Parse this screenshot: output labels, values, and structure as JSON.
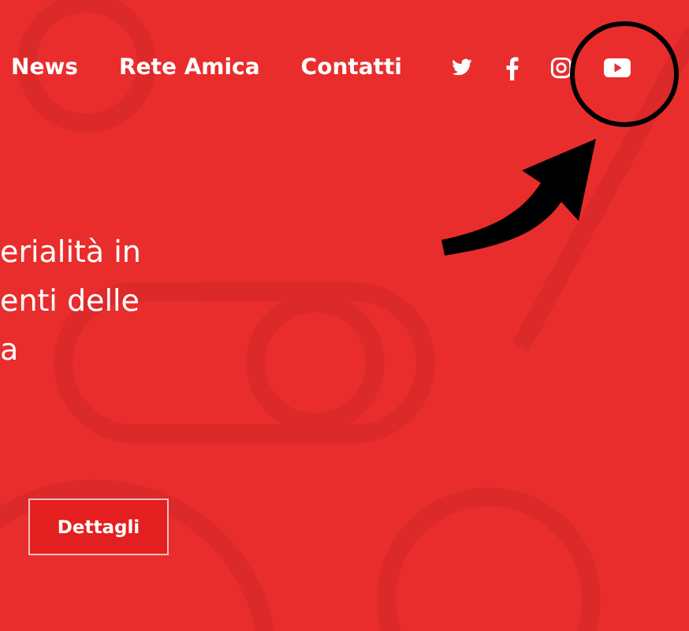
{
  "nav": {
    "items": [
      "News",
      "Rete Amica",
      "Contatti"
    ],
    "social": [
      {
        "kind": "twitter"
      },
      {
        "kind": "facebook"
      },
      {
        "kind": "instagram"
      },
      {
        "kind": "youtube"
      }
    ]
  },
  "hero": {
    "lines": [
      "erialità in",
      "enti delle",
      "a"
    ],
    "button": "Dettagli"
  }
}
